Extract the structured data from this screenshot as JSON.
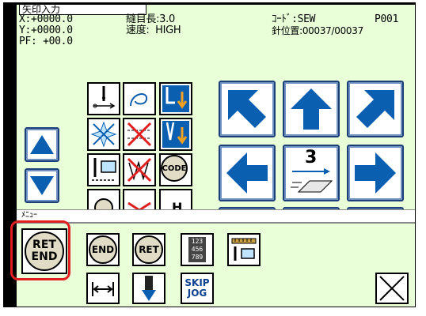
{
  "screen": {
    "title": "矢印入力",
    "coord_x": "X:+0000.0",
    "coord_y": "Y:+0000.0",
    "pf": "PF: +00.0",
    "stitch_length": "縫目長:3.0",
    "speed": "速度:  HIGH",
    "code": "ｺｰﾄﾞ:SEW",
    "pattern_no": "P001",
    "needle_position": "針位置:00037/00037"
  },
  "arrow_pad": {
    "step_label": "3"
  },
  "bottom_bar": {
    "label": "ﾒﾆｭｰ",
    "ret_end_top": "RET",
    "ret_end_bottom": "END",
    "end_label": "END",
    "ret_label": "RET",
    "numpad_text": "123 456 789",
    "skip_label": "SKIP",
    "jog_label": "JOG"
  },
  "colors": {
    "background": "#e8ffd8",
    "arrow_blue": "#0b5fb0",
    "highlight": "#e02020",
    "circle_fill": "#e0dcc6"
  }
}
